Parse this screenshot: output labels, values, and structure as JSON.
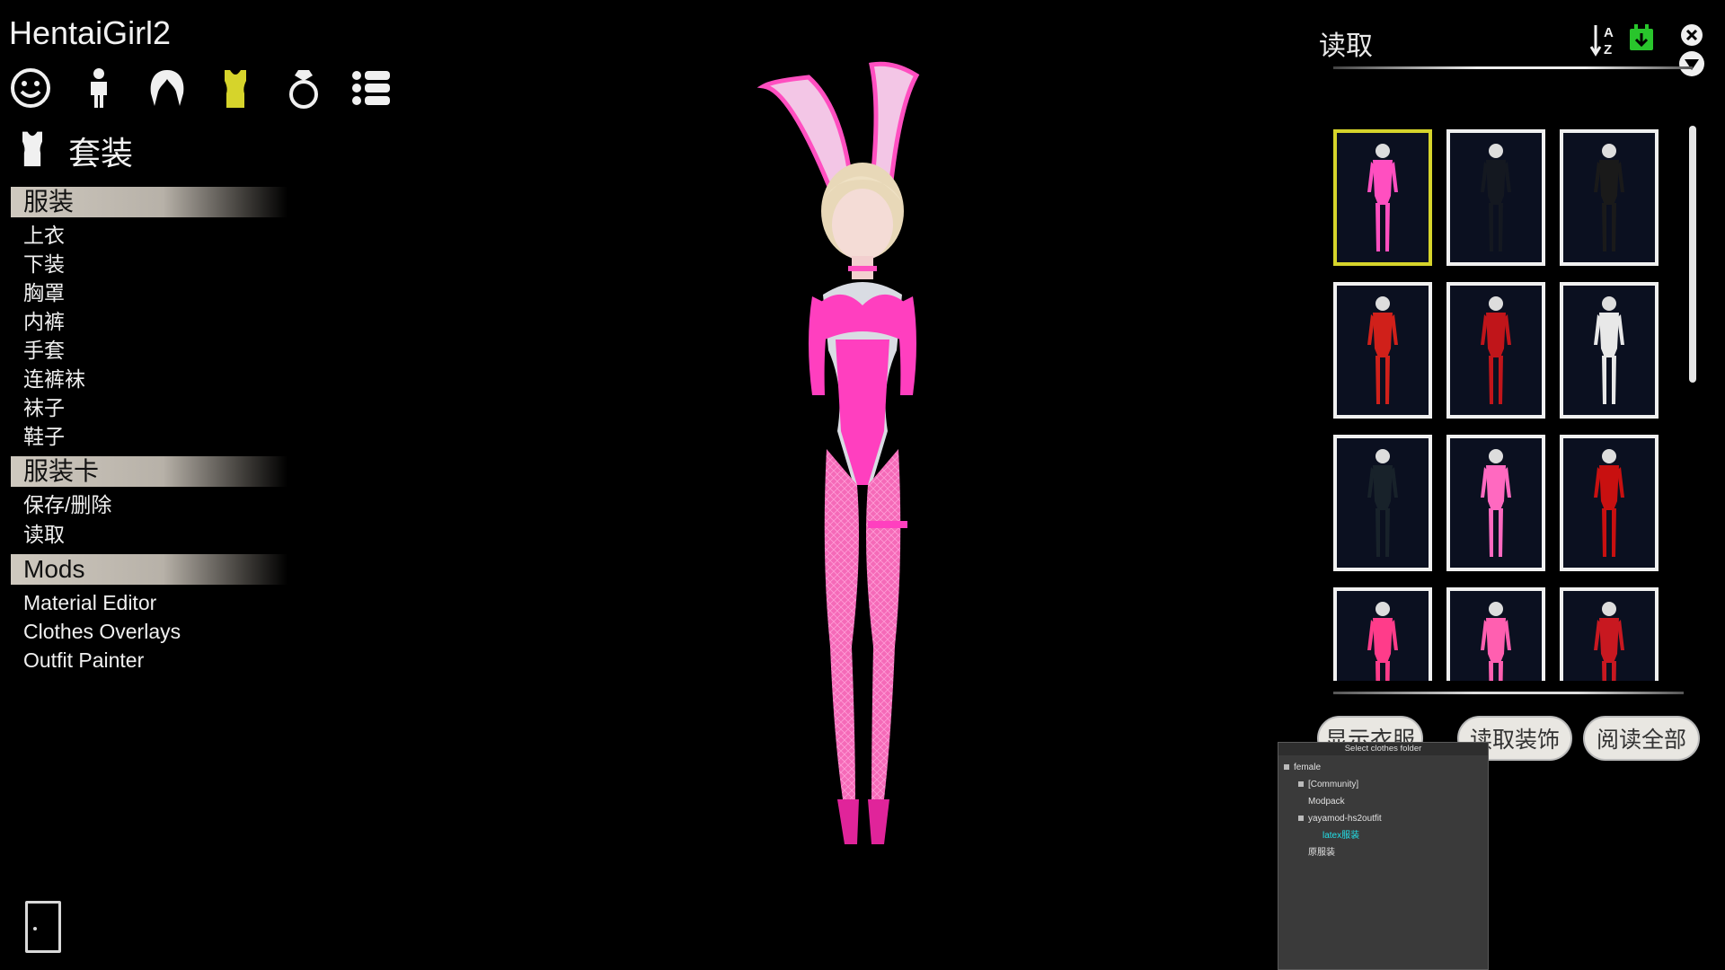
{
  "app": {
    "title": "HentaiGirl2"
  },
  "category_icons": [
    "face-icon",
    "body-icon",
    "hair-icon",
    "clothes-icon",
    "accessory-ring-icon",
    "list-menu-icon"
  ],
  "section": {
    "title": "套装"
  },
  "groups": {
    "clothing": {
      "header": "服装",
      "items": [
        "上衣",
        "下装",
        "胸罩",
        "内裤",
        "手套",
        "连裤袜",
        "袜子",
        "鞋子"
      ]
    },
    "clothing_card": {
      "header": "服装卡",
      "items": [
        "保存/删除",
        "读取"
      ]
    },
    "mods": {
      "header": "Mods",
      "items": [
        "Material Editor",
        "Clothes Overlays",
        "Outfit Painter"
      ]
    }
  },
  "load_panel": {
    "title": "读取",
    "buttons": {
      "show_clothes": "显示衣服",
      "load_accessories": "读取装饰",
      "read_all": "阅读全部"
    },
    "thumbnails": [
      {
        "outfit": "pink bunny",
        "color": "#ff4fc0",
        "selected": true
      },
      {
        "outfit": "black suit",
        "color": "#141820",
        "selected": false
      },
      {
        "outfit": "black corset",
        "color": "#1a1a1a",
        "selected": false
      },
      {
        "outfit": "red latex boots",
        "color": "#d0201a",
        "selected": false
      },
      {
        "outfit": "red harness",
        "color": "#c0151a",
        "selected": false
      },
      {
        "outfit": "cow print",
        "color": "#e8e8e8",
        "selected": false
      },
      {
        "outfit": "black latex",
        "color": "#18222a",
        "selected": false
      },
      {
        "outfit": "pink latex",
        "color": "#ff69c0",
        "selected": false
      },
      {
        "outfit": "red latex",
        "color": "#c81010",
        "selected": false
      },
      {
        "outfit": "pink dress",
        "color": "#ff3c8a",
        "selected": false
      },
      {
        "outfit": "pink green",
        "color": "#ff5fb0",
        "selected": false
      },
      {
        "outfit": "red nurse",
        "color": "#c81820",
        "selected": false
      }
    ]
  },
  "folder_popup": {
    "title": "Select clothes folder",
    "nodes": [
      {
        "label": "female",
        "indent": 0,
        "expanded": true
      },
      {
        "label": "[Community]",
        "indent": 1,
        "expanded": false
      },
      {
        "label": "Modpack",
        "indent": 1,
        "expanded": null
      },
      {
        "label": "yayamod-hs2outfit",
        "indent": 1,
        "expanded": true
      },
      {
        "label": "latex服装",
        "indent": 2,
        "expanded": null,
        "active": true
      },
      {
        "label": "原服装",
        "indent": 1,
        "expanded": null
      }
    ]
  },
  "colors": {
    "accent_yellow": "#d6d42b",
    "popup_active": "#22e0e8",
    "outfit_pink": "#ff3fbf"
  }
}
